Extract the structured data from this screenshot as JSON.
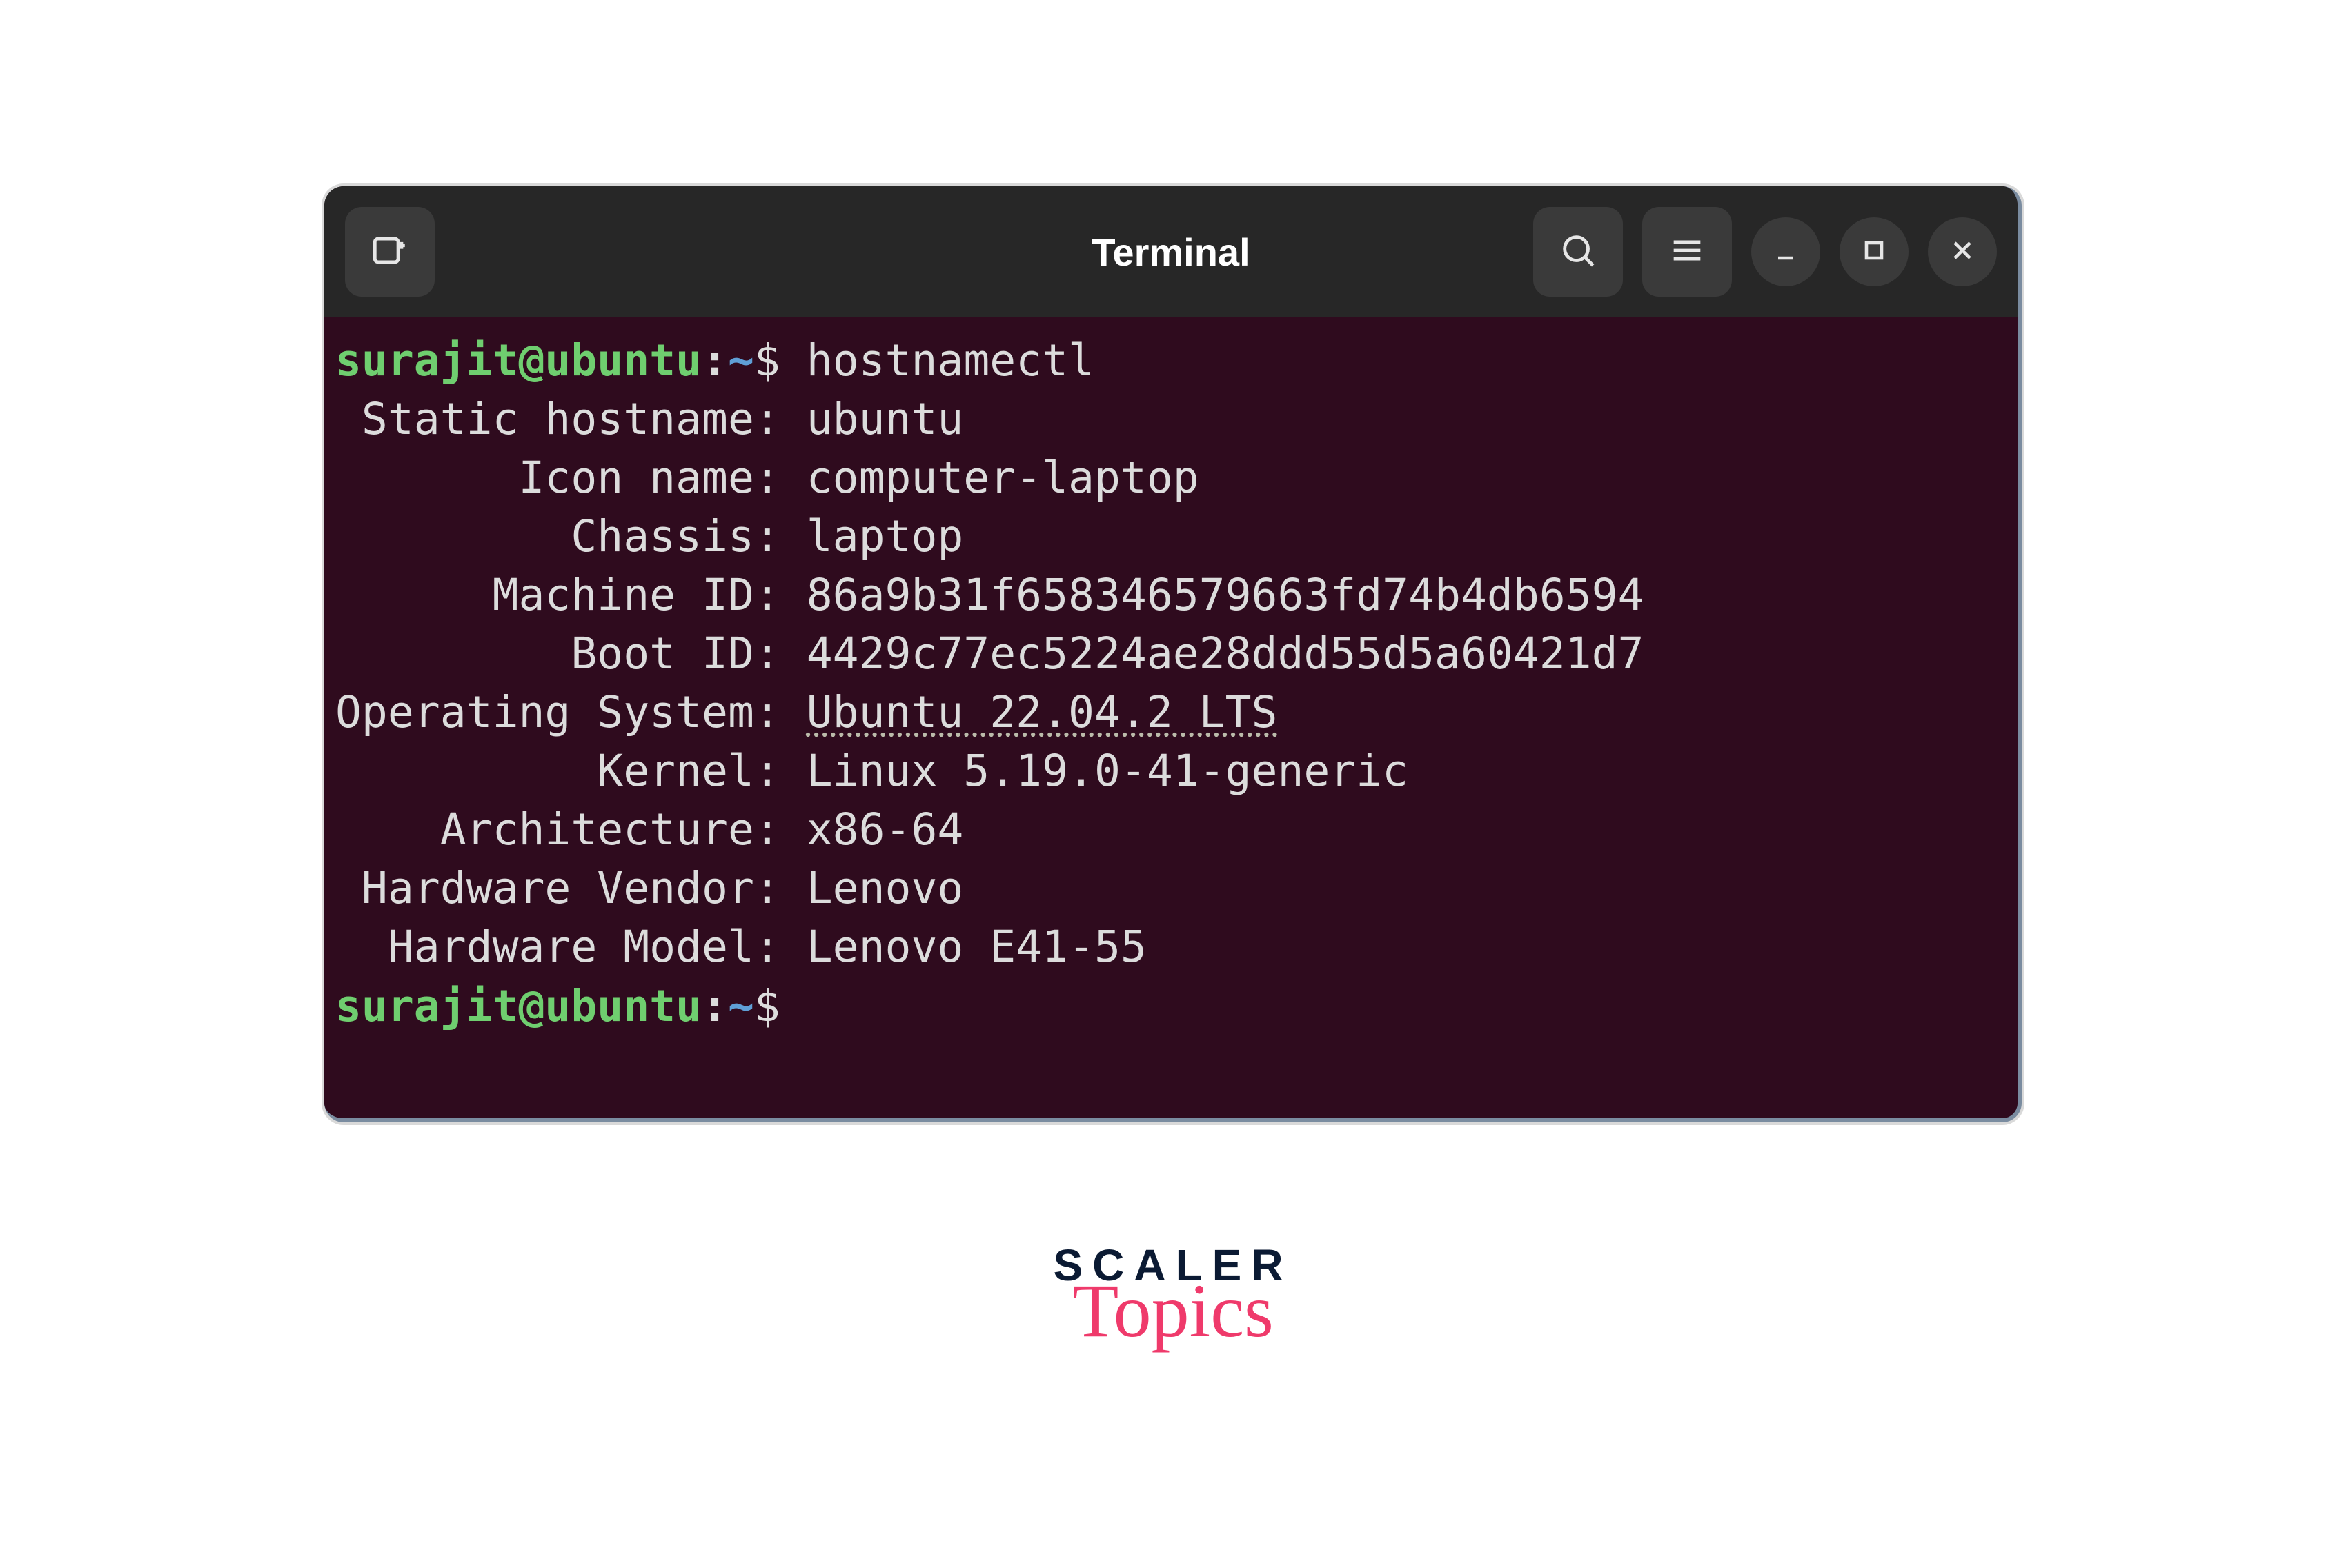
{
  "window": {
    "title": "Terminal"
  },
  "prompt": {
    "user_host": "surajit@ubuntu",
    "path": "~",
    "symbol": "$"
  },
  "command": "hostnamectl",
  "output": {
    "rows": [
      {
        "key": " Static hostname",
        "value": "ubuntu"
      },
      {
        "key": "       Icon name",
        "value": "computer-laptop"
      },
      {
        "key": "         Chassis",
        "value": "laptop"
      },
      {
        "key": "      Machine ID",
        "value": "86a9b31f658346579663fd74b4db6594"
      },
      {
        "key": "         Boot ID",
        "value": "4429c77ec5224ae28ddd55d5a60421d7"
      },
      {
        "key": "Operating System",
        "value": "Ubuntu 22.04.2 LTS",
        "underline": true
      },
      {
        "key": "          Kernel",
        "value": "Linux 5.19.0-41-generic"
      },
      {
        "key": "    Architecture",
        "value": "x86-64"
      },
      {
        "key": " Hardware Vendor",
        "value": "Lenovo"
      },
      {
        "key": "  Hardware Model",
        "value": "Lenovo E41-55"
      }
    ]
  },
  "icons": {
    "new_tab": "new-tab-icon",
    "search": "search-icon",
    "menu": "menu-icon",
    "minimize": "minimize-icon",
    "maximize": "maximize-icon",
    "close": "close-icon"
  },
  "branding": {
    "line1": "SCALER",
    "line2": "Topics"
  }
}
